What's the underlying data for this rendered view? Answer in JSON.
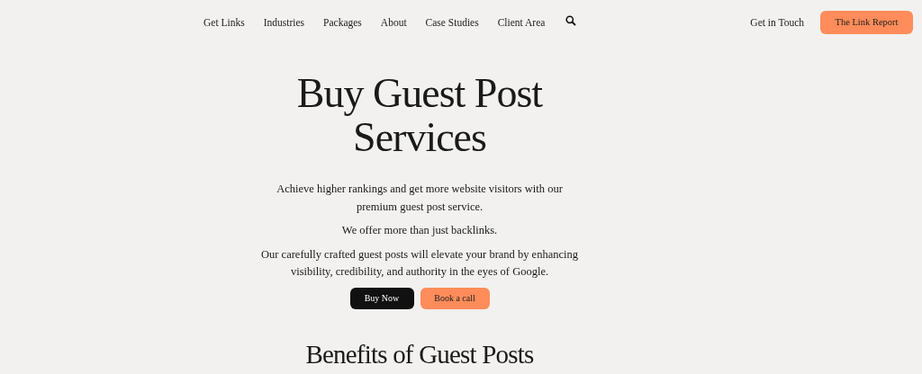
{
  "nav": {
    "links": [
      "Get Links",
      "Industries",
      "Packages",
      "About",
      "Case Studies",
      "Client Area"
    ],
    "contact_link": "Get in Touch",
    "report_button": "The Link Report"
  },
  "hero": {
    "title": "Buy Guest Post Services",
    "paragraphs": [
      "Achieve higher rankings and get more website visitors with our premium guest post service.",
      "We offer more than just backlinks.",
      "Our carefully crafted guest posts will elevate your brand by enhancing visibility, credibility, and authority in the eyes of Google."
    ],
    "buttons": [
      {
        "label": "Buy Now",
        "kind": "dark"
      },
      {
        "label": "Book a call",
        "kind": "accent"
      }
    ]
  },
  "section": {
    "title": "Benefits of Guest Posts"
  }
}
